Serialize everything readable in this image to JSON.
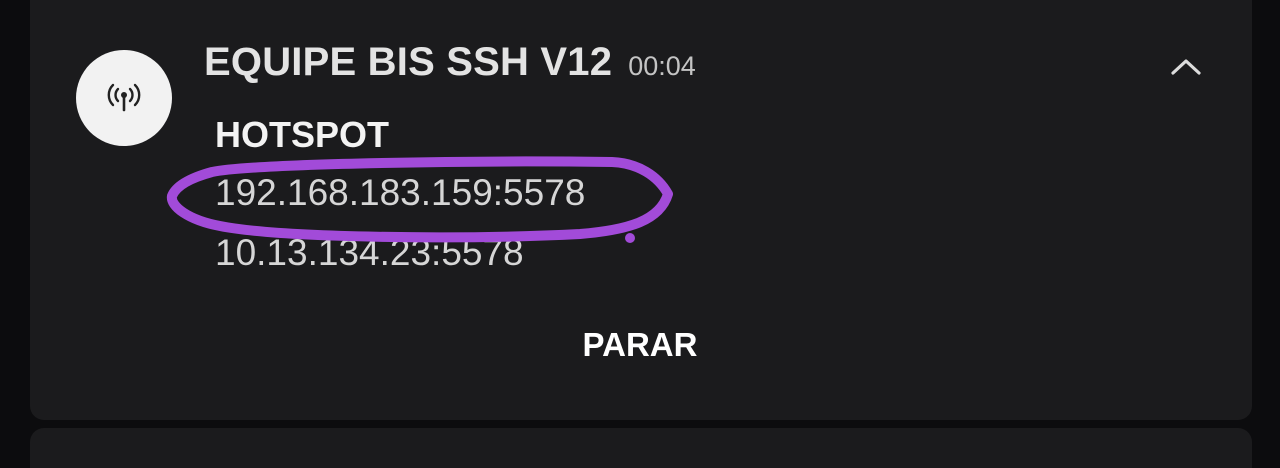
{
  "notification": {
    "app_title": "EQUIPE BIS SSH V12",
    "time": "00:04",
    "icon": "broadcast-antenna-icon",
    "collapse_icon": "chevron-up-icon",
    "heading": "HOTSPOT",
    "addresses": [
      "192.168.183.159:5578",
      "10.13.134.23:5578"
    ],
    "action_label": "PARAR"
  },
  "colors": {
    "card_background": "#1b1b1d",
    "highlight_stroke": "#a24bd9"
  }
}
